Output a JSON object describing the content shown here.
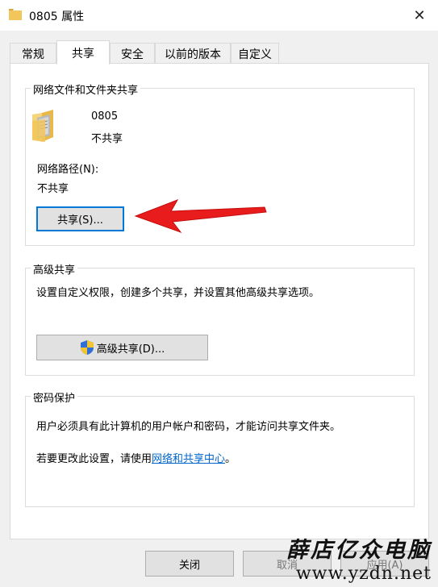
{
  "window": {
    "title": "0805 属性",
    "close_glyph": "✕"
  },
  "tabs": [
    {
      "label": "常规"
    },
    {
      "label": "共享"
    },
    {
      "label": "安全"
    },
    {
      "label": "以前的版本"
    },
    {
      "label": "自定义"
    }
  ],
  "network_share": {
    "group_label": "网络文件和文件夹共享",
    "folder_name": "0805",
    "share_status": "不共享",
    "path_label": "网络路径(N):",
    "path_value": "不共享",
    "share_button": "共享(S)..."
  },
  "advanced_share": {
    "group_label": "高级共享",
    "description": "设置自定义权限，创建多个共享，并设置其他高级共享选项。",
    "button": "高级共享(D)..."
  },
  "password_protect": {
    "group_label": "密码保护",
    "description": "用户必须具有此计算机的用户帐户和密码，才能访问共享文件夹。",
    "change_prefix": "若要更改此设置，请使用",
    "change_link": "网络和共享中心",
    "change_suffix": "。"
  },
  "bottom": {
    "close_button": "关闭",
    "cancel_button": "取消",
    "apply_button": "应用(A)"
  },
  "watermark": {
    "text": "薛店亿众电脑",
    "url": "www.yzdn.net"
  },
  "colors": {
    "accent": "#0078d7",
    "link": "#0066cc",
    "arrow": "#e81c1c",
    "folder": "#f2c65b"
  }
}
